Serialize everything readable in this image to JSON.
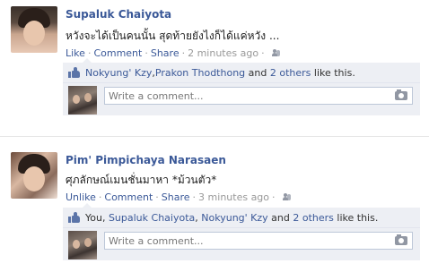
{
  "posts": [
    {
      "author": "Supaluk Chaiyota",
      "message": "หวังจะได้เป็นคนนั้น สุดท้ายยังไงก็ได้แค่หวัง ...",
      "actions": {
        "like": "Like",
        "comment": "Comment",
        "share": "Share",
        "time": "2 minutes ago"
      },
      "likes": {
        "name1": "Nokyung' Kzy",
        "sep1": ", ",
        "name2": "Prakon Thodthong",
        "and": " and ",
        "others": "2 others",
        "suffix": " like this."
      },
      "comment_placeholder": "Write a comment..."
    },
    {
      "author": "Pim' Pimpichaya Narasaen",
      "message": "ศุภลักษณ์เมนชั่นมาหา *ม้วนตัว*",
      "actions": {
        "like": "Unlike",
        "comment": "Comment",
        "share": "Share",
        "time": "3 minutes ago"
      },
      "likes": {
        "you": "You, ",
        "name1": "Supaluk Chaiyota",
        "sep1": ", ",
        "name2": "Nokyung' Kzy",
        "and": " and ",
        "others": "2 others",
        "suffix": " like this."
      },
      "comment_placeholder": "Write a comment..."
    }
  ],
  "icons": {
    "privacy": "friends-icon",
    "like": "thumbs-up-icon",
    "photo": "camera-icon"
  },
  "colors": {
    "link": "#3b5998",
    "ufi_background": "#edeff4",
    "meta_text": "#999999"
  }
}
